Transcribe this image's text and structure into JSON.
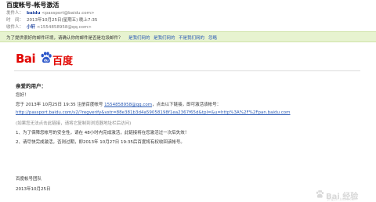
{
  "email": {
    "subject": "百度帐号-帐号激活",
    "sender": {
      "label": "发件人：",
      "name": "baidu",
      "address": "<passport@baidu.com>"
    },
    "time": {
      "label": "时　间：",
      "value": "2013年10月25日(星期五) 晚上7:35"
    },
    "recipient": {
      "label": "收件人：",
      "name": "小轩",
      "address": "<1554858958@qq.com>"
    }
  },
  "trust_bar": {
    "question": "为了提供很好的邮件环境，请确认你的邮件是否是垃圾邮件？",
    "options": [
      "是我们网的",
      "是我们网的",
      "不是我们网的",
      "忽略"
    ]
  },
  "logo": {
    "latin": "Bai",
    "cn": "百度"
  },
  "content": {
    "greeting": "亲爱的用户：",
    "hello": "您好！",
    "line1_pre": "您于 2013年 10月25日 19:35 注册百度帐号 ",
    "line1_email": "1554858958@qq.com",
    "line1_post": "，点击以下链接，即可激活该帐号：",
    "activation_link": "http://passport.baidu.com/v2/?regverify&vstr=88e381b3d4a59058198f1ea2367f65d&tpl=&u=http%3A%2F%2Fpan.baidu.com",
    "hint": "(如果您无法点击此链接，请将它复制到浏览器地址栏后访问)",
    "note1": "1、为了保障您帐号的安全性，请在 48小时内完成激活，此链接将在您激活过一次后失效！",
    "note2": "2、请尽快完成激活，否则过期，即2013年 10月27日 19:35后百度将有权收回该帐号。",
    "signature": "百度帐号团队",
    "date": "2013年10月25日"
  },
  "watermark": {
    "text": "Bai 经验",
    "sub": "jingyan.baidu.com"
  },
  "colors": {
    "accent": "#e10601",
    "link": "#2b5bb5",
    "bar": "#e7f3d0"
  }
}
